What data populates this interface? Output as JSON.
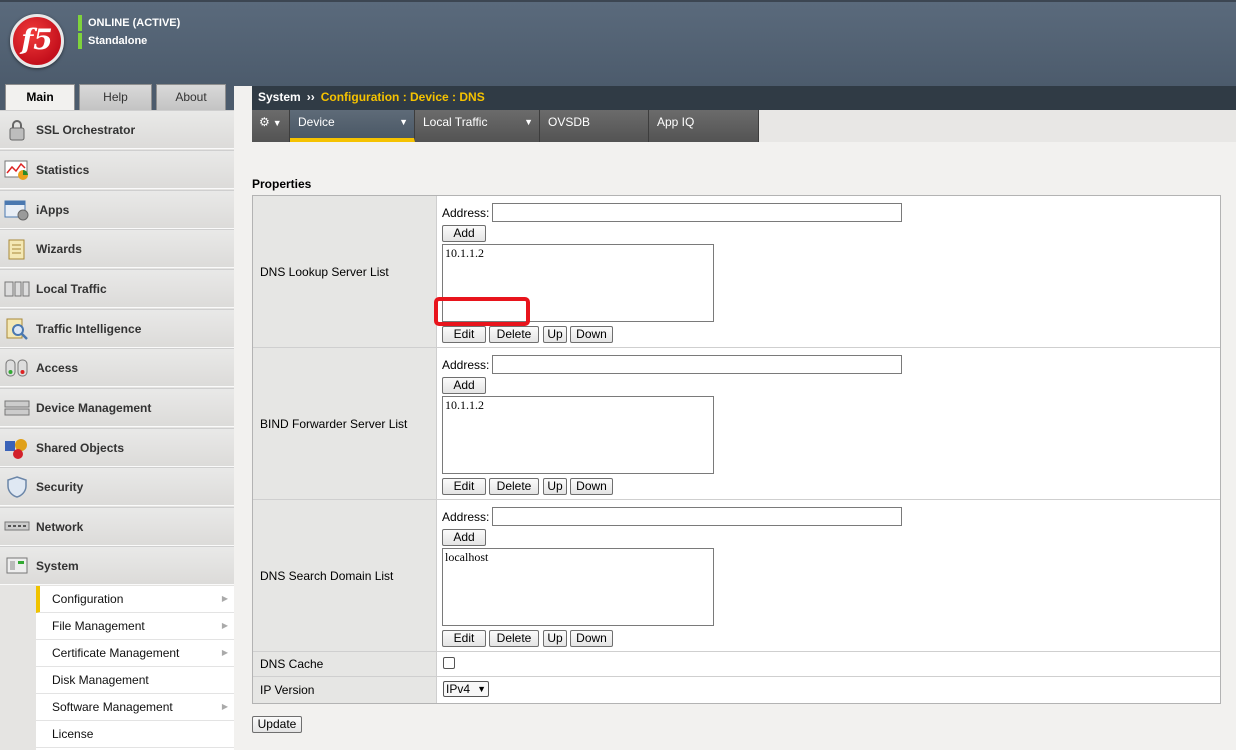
{
  "header": {
    "logo_text": "f5",
    "status_line1": "ONLINE (ACTIVE)",
    "status_line2": "Standalone"
  },
  "left_tabs": [
    "Main",
    "Help",
    "About"
  ],
  "sidebar": {
    "items": [
      {
        "label": "SSL Orchestrator",
        "icon": "lock-icon"
      },
      {
        "label": "Statistics",
        "icon": "chart-icon"
      },
      {
        "label": "iApps",
        "icon": "apps-icon"
      },
      {
        "label": "Wizards",
        "icon": "wizard-icon"
      },
      {
        "label": "Local Traffic",
        "icon": "traffic-icon"
      },
      {
        "label": "Traffic Intelligence",
        "icon": "magnifier-icon"
      },
      {
        "label": "Access",
        "icon": "access-icon"
      },
      {
        "label": "Device Management",
        "icon": "device-icon"
      },
      {
        "label": "Shared Objects",
        "icon": "shapes-icon"
      },
      {
        "label": "Security",
        "icon": "shield-icon"
      },
      {
        "label": "Network",
        "icon": "network-icon"
      },
      {
        "label": "System",
        "icon": "system-icon"
      }
    ],
    "system_sub": [
      "Configuration",
      "File Management",
      "Certificate Management",
      "Disk Management",
      "Software Management",
      "License"
    ]
  },
  "breadcrumb": {
    "root": "System",
    "separator": "››",
    "path": "Configuration : Device : DNS"
  },
  "subtabs": [
    "Device",
    "Local Traffic",
    "OVSDB",
    "App IQ"
  ],
  "properties": {
    "title": "Properties",
    "address_label": "Address:",
    "add_label": "Add",
    "edit_label": "Edit",
    "delete_label": "Delete",
    "up_label": "Up",
    "down_label": "Down",
    "dns_lookup": {
      "label": "DNS Lookup Server List",
      "address_value": "",
      "entries": [
        "10.1.1.2"
      ]
    },
    "bind_forwarder": {
      "label": "BIND Forwarder Server List",
      "address_value": "",
      "entries": [
        "10.1.1.2"
      ]
    },
    "search_domain": {
      "label": "DNS Search Domain List",
      "address_value": "",
      "entries": [
        "localhost"
      ]
    },
    "dns_cache": {
      "label": "DNS Cache",
      "checked": false
    },
    "ip_version": {
      "label": "IP Version",
      "value": "IPv4"
    }
  },
  "update_label": "Update",
  "colors": {
    "accent": "#f5c200",
    "highlight": "#e8141c",
    "status": "#7fd33c"
  }
}
